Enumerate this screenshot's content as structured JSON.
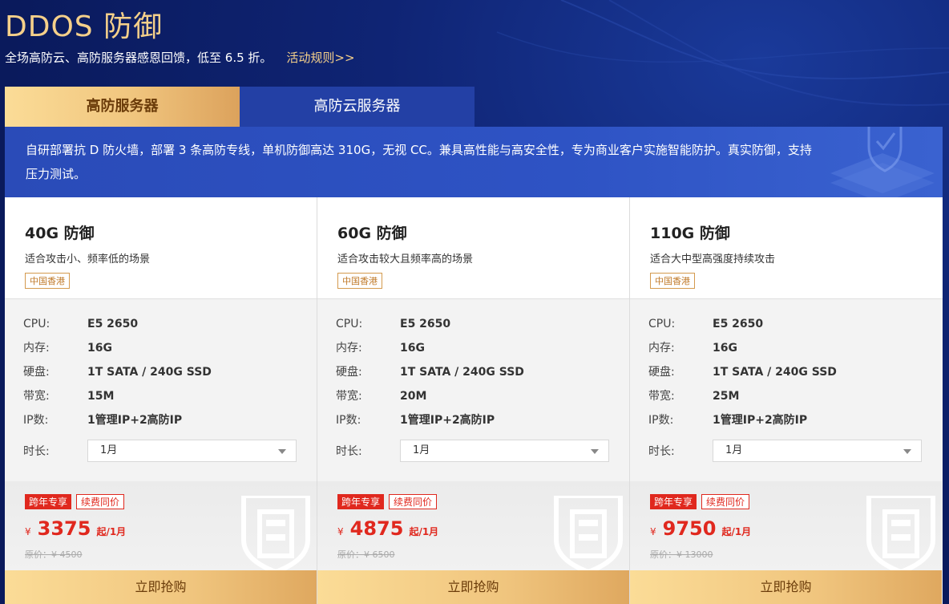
{
  "header": {
    "title": "DDOS 防御",
    "subtitle": "全场高防云、高防服务器感恩回馈，低至 6.5 折。",
    "rules_link": "活动规则>>"
  },
  "tabs": [
    {
      "label": "高防服务器",
      "active": true
    },
    {
      "label": "高防云服务器",
      "active": false
    }
  ],
  "description": "自研部署抗 D 防火墙，部署 3 条高防专线，单机防御高达 310G，无视 CC。兼具高性能与高安全性，专为商业客户实施智能防护。真实防御，支持压力测试。",
  "labels": {
    "cpu": "CPU:",
    "memory": "内存:",
    "disk": "硬盘:",
    "bandwidth": "带宽:",
    "ip": "IP数:",
    "duration": "时长:",
    "currency": "¥",
    "badge_hot": "跨年专享",
    "badge_renew": "续费同价",
    "buy": "立即抢购"
  },
  "cards": [
    {
      "name": "40G 防御",
      "scene": "适合攻击小、频率低的场景",
      "region": "中国香港",
      "cpu": "E5 2650",
      "memory": "16G",
      "disk": "1T SATA / 240G SSD",
      "bandwidth": "15M",
      "ip": "1管理IP+2高防IP",
      "duration": "1月",
      "price": "3375",
      "price_unit": "起/1月",
      "original_price": "原价：¥ 4500"
    },
    {
      "name": "60G 防御",
      "scene": "适合攻击较大且频率高的场景",
      "region": "中国香港",
      "cpu": "E5 2650",
      "memory": "16G",
      "disk": "1T SATA / 240G SSD",
      "bandwidth": "20M",
      "ip": "1管理IP+2高防IP",
      "duration": "1月",
      "price": "4875",
      "price_unit": "起/1月",
      "original_price": "原价：¥ 6500"
    },
    {
      "name": "110G 防御",
      "scene": "适合大中型高强度持续攻击",
      "region": "中国香港",
      "cpu": "E5 2650",
      "memory": "16G",
      "disk": "1T SATA / 240G SSD",
      "bandwidth": "25M",
      "ip": "1管理IP+2高防IP",
      "duration": "1月",
      "price": "9750",
      "price_unit": "起/1月",
      "original_price": "原价：¥ 13000"
    }
  ],
  "colors": {
    "background": "#0b1d63",
    "gold": "#f5d08a",
    "accent_red": "#e0281e",
    "tab_inactive": "#2340a5"
  }
}
